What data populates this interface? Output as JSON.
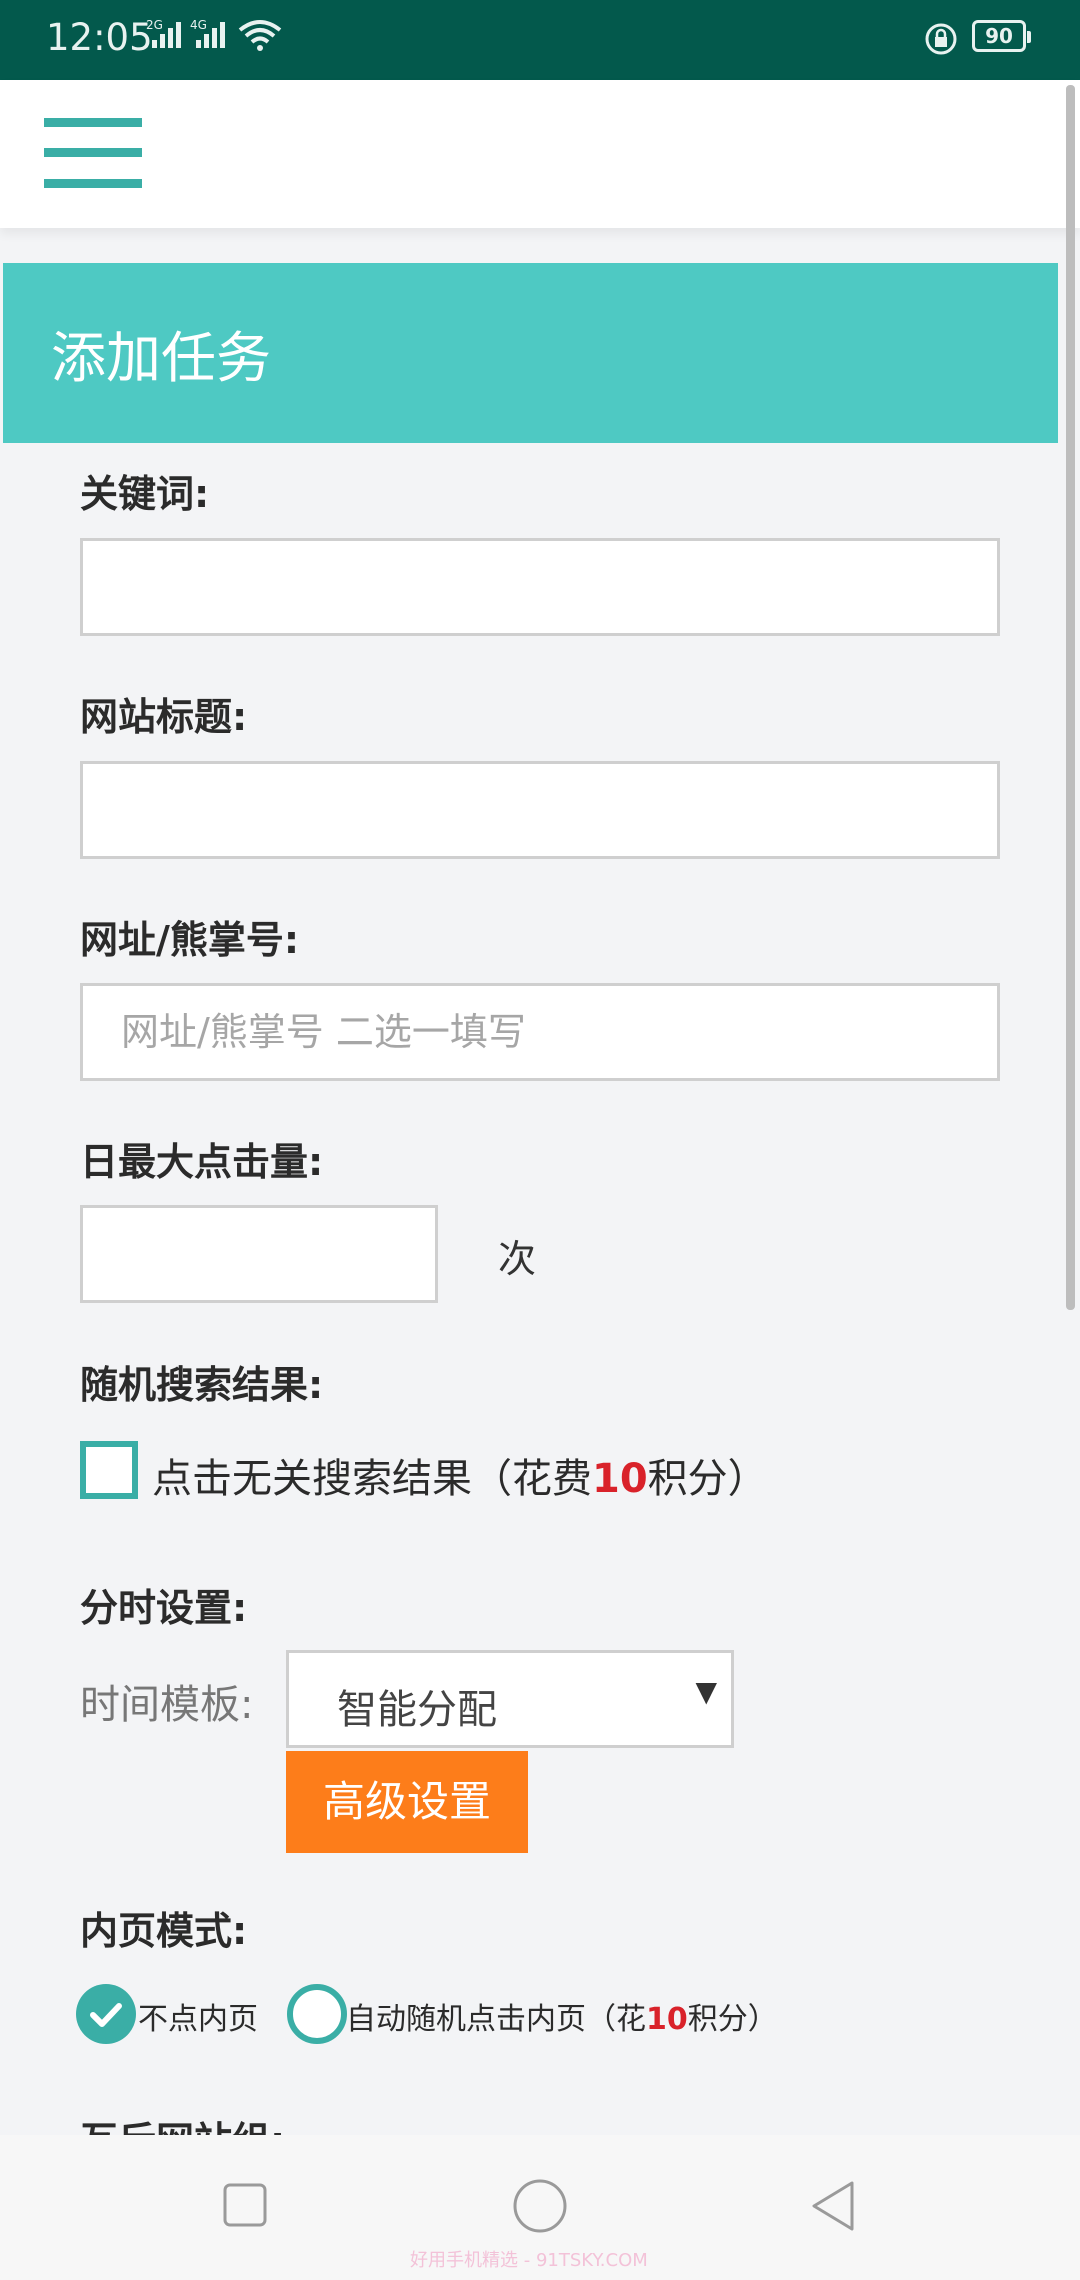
{
  "status_bar": {
    "time": "12:05",
    "signal1_tag": "2G",
    "signal2_tag": "4G",
    "battery": "90"
  },
  "page": {
    "title": "添加任务"
  },
  "form": {
    "keyword": {
      "label": "关键词:",
      "value": ""
    },
    "site_title": {
      "label": "网站标题:",
      "value": ""
    },
    "url": {
      "label": "网址/熊掌号:",
      "placeholder": "网址/熊掌号 二选一填写",
      "value": ""
    },
    "daily_clicks": {
      "label": "日最大点击量:",
      "value": "",
      "unit": "次"
    },
    "random_search": {
      "label": "随机搜索结果:",
      "checkbox_text_before": "点击无关搜索结果（花费",
      "checkbox_cost": "10",
      "checkbox_text_after": "积分）",
      "checked": false
    },
    "time_share": {
      "label": "分时设置:",
      "template_label": "时间模板:",
      "template_value": "智能分配",
      "advanced_button": "高级设置"
    },
    "inner_page": {
      "label": "内页模式:",
      "option1": "不点内页",
      "option2_before": "自动随机点击内页（花",
      "option2_cost": "10",
      "option2_after": "积分）",
      "selected": "option1"
    },
    "next_section_partial": "互斥网站组:"
  },
  "nav_bar": {
    "watermark": "好用手机精选 - 91TSKY.COM"
  },
  "colors": {
    "status_bar": "#03594c",
    "accent": "#3aaea6",
    "banner": "#4ec9c3",
    "button": "#fd7d1a",
    "highlight": "#d9222a"
  }
}
